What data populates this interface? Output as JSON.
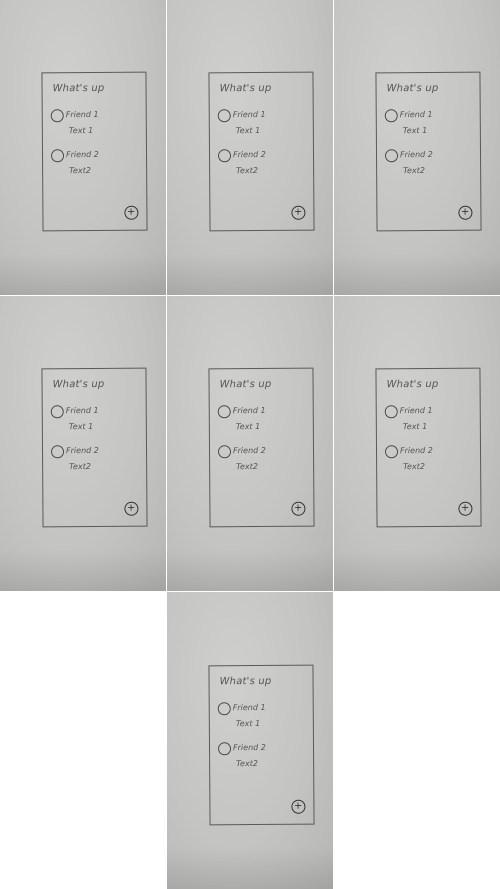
{
  "sketch": {
    "title": "What's up",
    "friends": [
      {
        "name": "Friend 1",
        "text": "Text 1"
      },
      {
        "name": "Friend 2",
        "text": "Text2"
      }
    ],
    "fab_icon": "plus-circle-icon",
    "fab_glyph": "+"
  },
  "photo_count": 7,
  "colors": {
    "paper": "#c4c4c2",
    "ink": "#4a4a4a",
    "background": "#ffffff"
  }
}
